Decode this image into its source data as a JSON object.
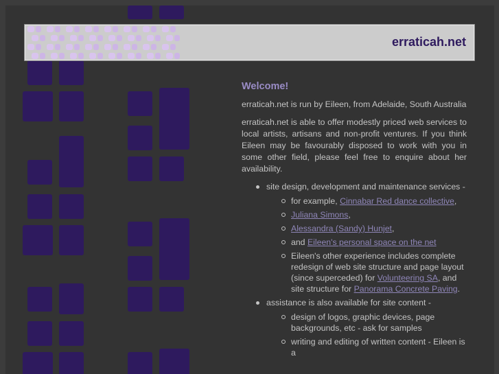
{
  "header": {
    "site_title": "erraticah.net"
  },
  "main": {
    "heading": "Welcome!",
    "intro": "erraticah.net is run by Eileen, from Adelaide, South Australia",
    "offer": "erraticah.net is able to offer modestly priced web services to local artists, artisans and non-profit ventures. If you think Eileen may be favourably disposed to work with you in some other field, please feel free to enquire about her availability.",
    "services": {
      "label": "site design, development and maintenance services -",
      "item1_prefix": "for example, ",
      "link_cinnabar": "Cinnabar Red dance collective",
      "item1_suffix": ",",
      "link_juliana": "Juliana Simons",
      "item2_suffix": ",",
      "link_alessandra": "Alessandra (Sandy) Hunjet",
      "item3_suffix": ",",
      "item4_prefix": "and ",
      "link_eileen": "Eileen's personal space on the net",
      "item5_a": "Eileen's other experience includes complete redesign of web site structure and page layout (since superceded) for ",
      "link_volunteering": "Volunteering SA",
      "item5_b": ", and site structure for ",
      "link_panorama": "Panorama Concrete Paving",
      "item5_c": "."
    },
    "content_help": {
      "label": "assistance is also available for site content -",
      "item1": "design of logos, graphic devices, page backgrounds, etc - ask for samples",
      "item2": "writing and editing of written content - Eileen is a"
    }
  },
  "colors": {
    "accent": "#9a8cc6",
    "tile": "#2e1a5e",
    "background": "#333333",
    "header_bg": "#cccccc"
  }
}
